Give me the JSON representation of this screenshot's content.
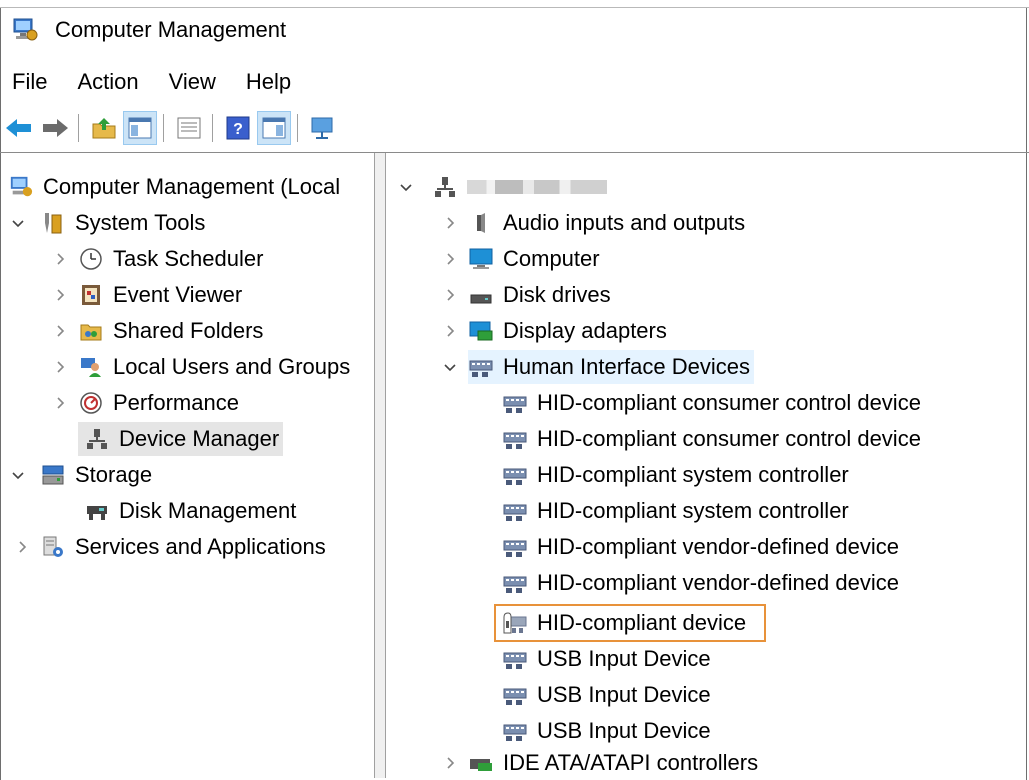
{
  "window": {
    "title": "Computer Management"
  },
  "menu": [
    "File",
    "Action",
    "View",
    "Help"
  ],
  "toolbar": {
    "buttons": [
      "back-arrow-icon",
      "forward-arrow-icon",
      "up-folder-icon",
      "show-hide-tree-icon",
      "properties-icon",
      "help-icon",
      "show-hide-action-pane-icon",
      "monitor-icon"
    ]
  },
  "left_tree": {
    "root": "Computer Management (Local",
    "system_tools": "System Tools",
    "task_scheduler": "Task Scheduler",
    "event_viewer": "Event Viewer",
    "shared_folders": "Shared Folders",
    "local_users": "Local Users and Groups",
    "performance": "Performance",
    "device_manager": "Device Manager",
    "storage": "Storage",
    "disk_management": "Disk Management",
    "services": "Services and Applications"
  },
  "right_tree": {
    "audio": "Audio inputs and outputs",
    "computer": "Computer",
    "disk_drives": "Disk drives",
    "display": "Display adapters",
    "hid": "Human Interface Devices",
    "hid_items": [
      "HID-compliant consumer control device",
      "HID-compliant consumer control device",
      "HID-compliant system controller",
      "HID-compliant system controller",
      "HID-compliant vendor-defined device",
      "HID-compliant vendor-defined device",
      "HID-compliant device",
      "USB Input Device",
      "USB Input Device",
      "USB Input Device"
    ],
    "ide": "IDE ATA/ATAPI controllers"
  },
  "colors": {
    "highlight_box": "#e8923a",
    "selection": "#e5e5e5",
    "hid_selection": "#e5f3ff"
  }
}
